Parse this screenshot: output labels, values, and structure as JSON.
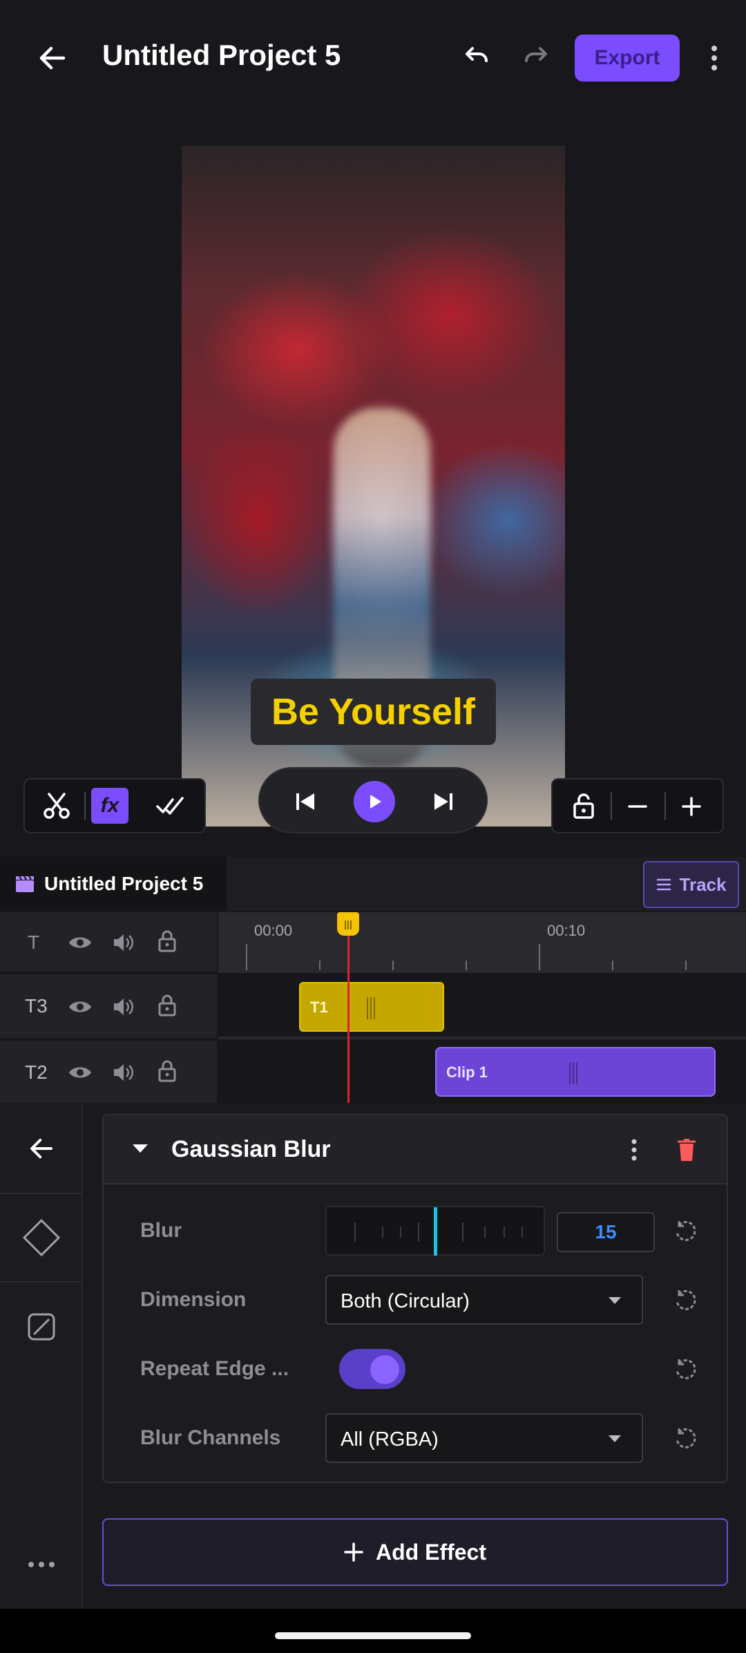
{
  "header": {
    "title": "Untitled Project 5",
    "export_label": "Export"
  },
  "preview": {
    "caption": "Be Yourself"
  },
  "preview_tools": {
    "fx_label": "fx"
  },
  "timeline": {
    "project_tab": "Untitled Project 5",
    "track_button": "Track",
    "ruler_labels": [
      "00:00",
      "00:10"
    ],
    "header_row_label": "T",
    "tracks": [
      {
        "label": "T3",
        "clip": "T1"
      },
      {
        "label": "T2",
        "clip": "Clip 1"
      }
    ]
  },
  "effect": {
    "name": "Gaussian Blur",
    "properties": {
      "blur_label": "Blur",
      "blur_value": "15",
      "dimension_label": "Dimension",
      "dimension_value": "Both (Circular)",
      "repeat_label": "Repeat Edge ...",
      "repeat_on": true,
      "channels_label": "Blur Channels",
      "channels_value": "All (RGBA)"
    }
  },
  "add_effect_label": "Add Effect",
  "colors": {
    "accent": "#7c4dff",
    "text_clip": "#c4a800",
    "video_clip": "#6c45d6",
    "playhead": "#e02424",
    "caption_text": "#f5d000"
  }
}
